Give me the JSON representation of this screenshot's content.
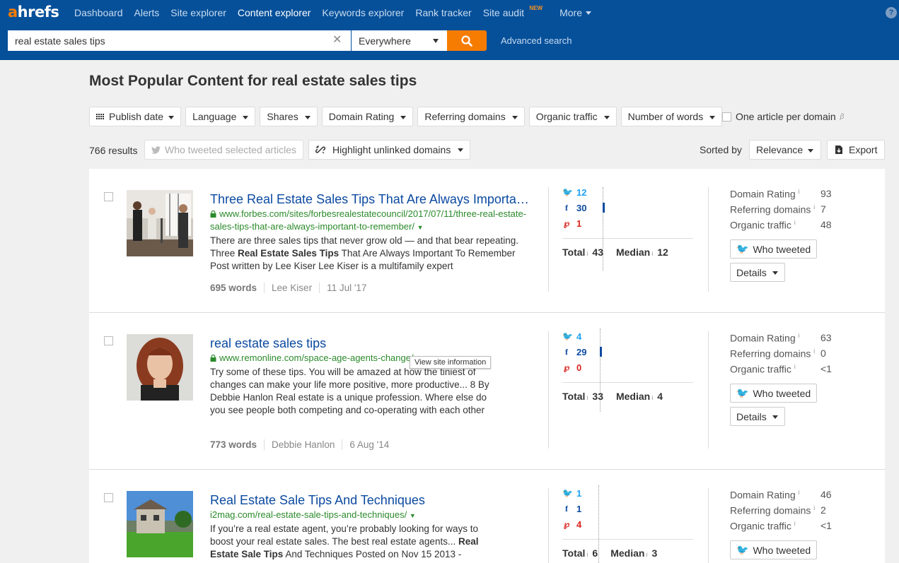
{
  "brand": {
    "logo_a": "a",
    "logo_rest": "hrefs",
    "accent": "#f57c00",
    "nav_bg": "#06509a"
  },
  "nav": {
    "items": [
      {
        "label": "Dashboard",
        "active": false
      },
      {
        "label": "Alerts",
        "active": false
      },
      {
        "label": "Site explorer",
        "active": false
      },
      {
        "label": "Content explorer",
        "active": true
      },
      {
        "label": "Keywords explorer",
        "active": false
      },
      {
        "label": "Rank tracker",
        "active": false
      },
      {
        "label": "Site audit",
        "active": false,
        "badge": "NEW"
      }
    ],
    "more": "More",
    "help": "?"
  },
  "search": {
    "query": "real estate sales tips",
    "scope": "Everywhere",
    "advanced": "Advanced search"
  },
  "page_title": "Most Popular Content for real estate sales tips",
  "filters": [
    "Publish date",
    "Language",
    "Shares",
    "Domain Rating",
    "Referring domains",
    "Organic traffic",
    "Number of words"
  ],
  "one_per_domain": {
    "label": "One article per domain",
    "beta": "β"
  },
  "results": {
    "count": "766 results",
    "who_tweeted": "Who tweeted selected articles",
    "highlight": "Highlight unlinked domains",
    "sorted_by": "Sorted by",
    "sort_value": "Relevance",
    "export": "Export"
  },
  "labels": {
    "total": "Total",
    "median": "Median",
    "info": "i",
    "domain_rating": "Domain Rating",
    "referring_domains": "Referring domains",
    "organic_traffic": "Organic traffic",
    "who_tweeted": "Who tweeted",
    "details": "Details"
  },
  "tooltip": "View site information",
  "articles": [
    {
      "title": "Three Real Estate Sales Tips That Are Always Important To Remember",
      "url": "www.forbes.com/sites/forbesrealestatecouncil/2017/07/11/three-real-estate-sales-tips-that-are-always-important-to-remember/",
      "secure": true,
      "snippet_parts": [
        "There are three sales tips that never grow old — and that bear repeat­ing. Three ",
        "Real Estate Sales Tips",
        " That Are Always Important To Re­member Post written by Lee Kiser Lee Kiser is a multifamily expert"
      ],
      "words": "695 words",
      "author": "Lee Kiser",
      "date": "11 Jul '17",
      "twitter": "12",
      "facebook": "30",
      "pinterest": "1",
      "total": "43",
      "median": "12",
      "domain_rating": "93",
      "referring_domains": "7",
      "organic_traffic": "48"
    },
    {
      "title": "real estate sales tips",
      "url": "www.remonline.com/space-age-agents-change/",
      "secure": true,
      "snippet_parts": [
        "Try some of these tips. You will be amazed at how the tiniest of changes can make your life more positive, more productive... 8 By Debbie Hanlon Real estate is a unique profession. Where else do you see people both competing and co-operating with each other",
        "",
        ""
      ],
      "words": "773 words",
      "author": "Debbie Hanlon",
      "date": "6 Aug '14",
      "twitter": "4",
      "facebook": "29",
      "pinterest": "0",
      "total": "33",
      "median": "4",
      "domain_rating": "63",
      "referring_domains": "0",
      "organic_traffic": "<1"
    },
    {
      "title": "Real Estate Sale Tips And Techniques",
      "url": "i2mag.com/real-estate-sale-tips-and-techniques/",
      "secure": false,
      "snippet_parts": [
        "If you’re a real estate agent, you’re probably looking for ways to boost your real estate sales. The best real estate agents... ",
        "Real Estate Sale Tips",
        " And Techniques Posted on Nov 15 2013 -"
      ],
      "words": "",
      "author": "",
      "date": "",
      "twitter": "1",
      "facebook": "1",
      "pinterest": "4",
      "total": "6",
      "median": "3",
      "domain_rating": "46",
      "referring_domains": "2",
      "organic_traffic": "<1"
    }
  ]
}
